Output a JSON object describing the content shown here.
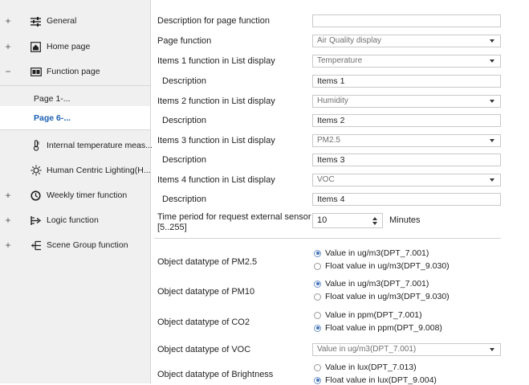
{
  "sidebar": {
    "general": "General",
    "home_page": "Home page",
    "function_page": "Function page",
    "page1": "Page 1-...",
    "page6": "Page 6-...",
    "internal_temp": "Internal temperature meas...",
    "human_centric": "Human Centric Lighting(H...",
    "weekly_timer": "Weekly timer function",
    "logic_function": "Logic function",
    "scene_group": "Scene Group function",
    "expand": "+",
    "collapse": "−"
  },
  "form": {
    "description_page_label": "Description for page function",
    "description_page_value": "",
    "page_function_label": "Page function",
    "page_function_value": "Air Quality display",
    "item1_label": "Items 1 function in List display",
    "item1_value": "Temperature",
    "item1_desc_label": "Description",
    "item1_desc_value": "Items 1",
    "item2_label": "Items 2 function in List display",
    "item2_value": "Humidity",
    "item2_desc_label": "Description",
    "item2_desc_value": "Items 2",
    "item3_label": "Items 3 function in List display",
    "item3_value": "PM2.5",
    "item3_desc_label": "Description",
    "item3_desc_value": "Items 3",
    "item4_label": "Items 4 function in List display",
    "item4_value": "VOC",
    "item4_desc_label": "Description",
    "item4_desc_value": "Items 4",
    "time_period_label1": "Time period for request external sensor",
    "time_period_label2": "[5..255]",
    "time_period_value": "10",
    "time_period_unit": "Minutes",
    "pm25_label": "Object datatype of PM2.5",
    "pm25_opt1": "Value in ug/m3(DPT_7.001)",
    "pm25_opt2": "Float value in ug/m3(DPT_9.030)",
    "pm10_label": "Object datatype of PM10",
    "pm10_opt1": "Value in ug/m3(DPT_7.001)",
    "pm10_opt2": "Float value in ug/m3(DPT_9.030)",
    "co2_label": "Object datatype of CO2",
    "co2_opt1": "Value in ppm(DPT_7.001)",
    "co2_opt2": "Float value in ppm(DPT_9.008)",
    "voc_label": "Object datatype of VOC",
    "voc_value": "Value in ug/m3(DPT_7.001)",
    "brightness_label": "Object datatype of Brightness",
    "brightness_opt1": "Value in lux(DPT_7.013)",
    "brightness_opt2": "Float value in lux(DPT_9.004)"
  },
  "selections": {
    "pm25": 1,
    "pm10": 1,
    "co2": 2,
    "brightness": 2
  },
  "icons": {
    "general": "sliders-icon",
    "home_page": "home-icon",
    "function_page": "grid-icon",
    "internal_temp": "thermometer-icon",
    "human_centric": "sun-icon",
    "weekly_timer": "clock-icon",
    "logic_function": "logic-icon",
    "scene_group": "scene-icon"
  },
  "colors": {
    "selected_text": "#1a5fb4",
    "sidebar_bg": "#f0f0f0",
    "radio_on": "#3f73b8"
  }
}
